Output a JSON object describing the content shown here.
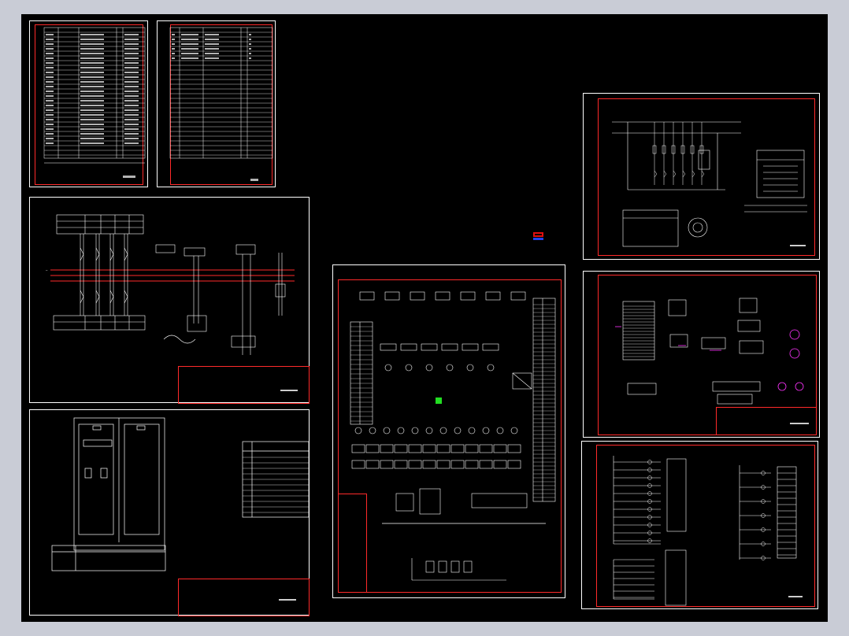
{
  "colors": {
    "background": "#000000",
    "sheet_border": "#ffffff",
    "frame_red": "#ff2a2a",
    "line_white": "#ffffff",
    "accent_magenta": "#ff33ff",
    "accent_green": "#22dd22",
    "logo_red": "#e01010",
    "logo_blue": "#2244ee",
    "viewport_bg": "#c9ccd6"
  },
  "sheets": [
    {
      "id": "parts-list-1",
      "label": "parts-list-sheet-1"
    },
    {
      "id": "parts-list-2",
      "label": "parts-list-sheet-2"
    },
    {
      "id": "main-circuit",
      "label": "main-circuit-sheet"
    },
    {
      "id": "cabinet-layout",
      "label": "cabinet-layout-sheet"
    },
    {
      "id": "panel-wiring",
      "label": "panel-wiring-sheet"
    },
    {
      "id": "control-circuit-1",
      "label": "control-circuit-sheet-1"
    },
    {
      "id": "terminal-diagram",
      "label": "terminal-diagram-sheet"
    },
    {
      "id": "control-circuit-2",
      "label": "control-circuit-sheet-2"
    }
  ],
  "icons": {
    "logo": "cad-logo-icon"
  }
}
